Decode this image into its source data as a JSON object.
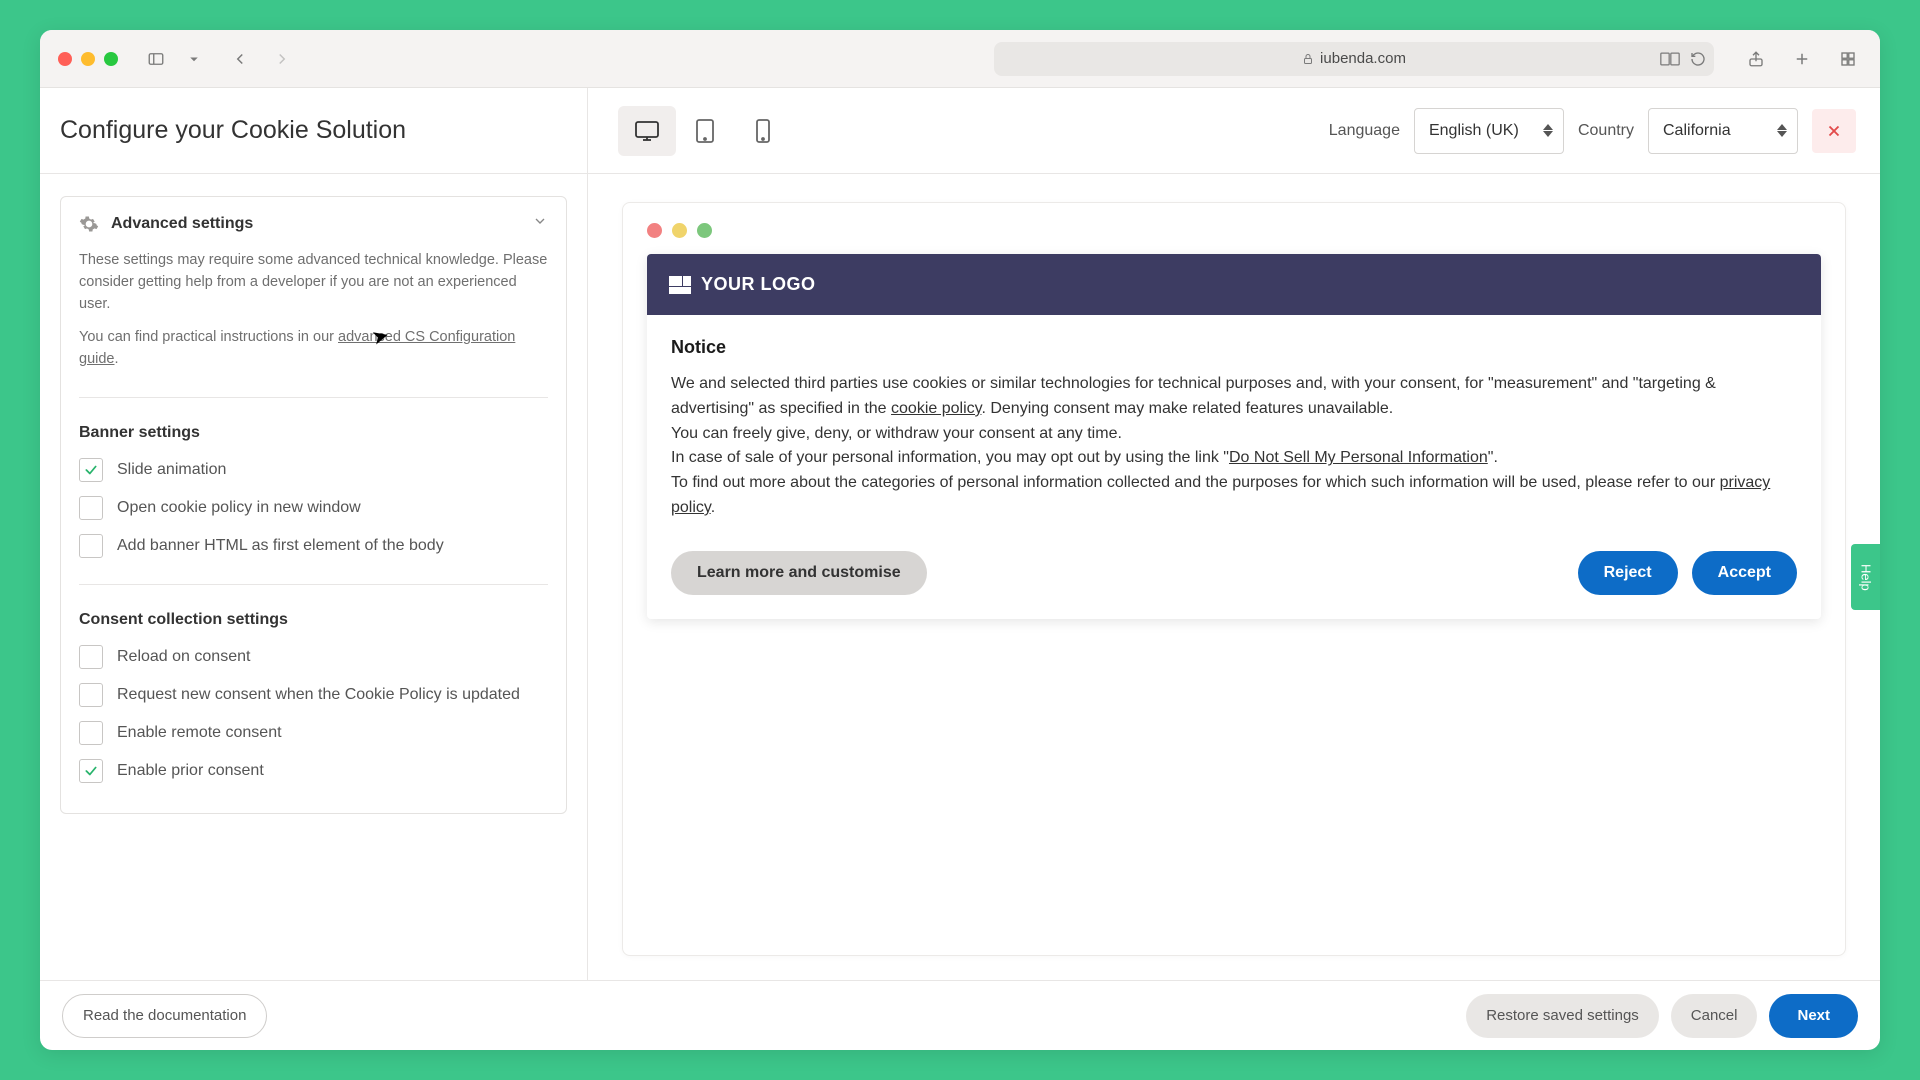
{
  "browser": {
    "address": "iubenda.com"
  },
  "header": {
    "title": "Configure your Cookie Solution",
    "language_label": "Language",
    "language_value": "English (UK)",
    "country_label": "Country",
    "country_value": "California"
  },
  "advanced": {
    "title": "Advanced settings",
    "desc": "These settings may require some advanced technical knowledge. Please consider getting help from a developer if you are not an experienced user.",
    "guide_pre": "You can find practical instructions in our ",
    "guide_link": "advanced CS Configuration guide"
  },
  "banner_settings": {
    "title": "Banner settings",
    "items": [
      {
        "label": "Slide animation",
        "checked": true
      },
      {
        "label": "Open cookie policy in new window",
        "checked": false
      },
      {
        "label": "Add banner HTML as first element of the body",
        "checked": false
      }
    ]
  },
  "consent_settings": {
    "title": "Consent collection settings",
    "items": [
      {
        "label": "Reload on consent",
        "checked": false
      },
      {
        "label": "Request new consent when the Cookie Policy is updated",
        "checked": false
      },
      {
        "label": "Enable remote consent",
        "checked": false
      },
      {
        "label": "Enable prior consent",
        "checked": true
      }
    ]
  },
  "notice": {
    "logo_text": "YOUR LOGO",
    "title": "Notice",
    "t1a": "We and selected third parties use cookies or similar technologies for technical purposes and, with your consent, for \"measurement\" and \"targeting & advertising\" as specified in the ",
    "cookie_policy": "cookie policy",
    "t1b": ". Denying consent may make related features unavailable.",
    "t2": "You can freely give, deny, or withdraw your consent at any time.",
    "t3a": "In case of sale of your personal information, you may opt out by using the link \"",
    "dnsmpi": "Do Not Sell My Personal Information",
    "t3b": "\".",
    "t4a": "To find out more about the categories of personal information collected and the purposes for which such information will be used, please refer to our ",
    "privacy_policy": "privacy policy",
    "t4b": ".",
    "learn": "Learn more and customise",
    "reject": "Reject",
    "accept": "Accept"
  },
  "footer": {
    "docs": "Read the documentation",
    "restore": "Restore saved settings",
    "cancel": "Cancel",
    "next": "Next"
  },
  "help": "Help"
}
